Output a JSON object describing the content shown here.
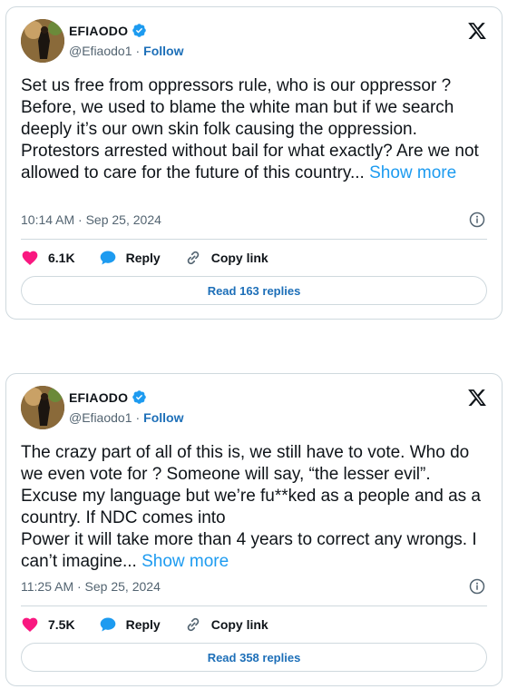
{
  "tweets": [
    {
      "author": {
        "name": "EFIAODO",
        "handle": "@Efiaodo1",
        "follow_label": "Follow"
      },
      "text": "Set us free from oppressors rule, who is our oppressor ? Before, we used to blame the white man but if we search deeply it’s our own skin folk causing the oppression. Protestors arrested without bail for what exactly? Are we not allowed to care for the future of this country...",
      "show_more": "Show more",
      "timestamp": "10:14 AM · Sep 25, 2024",
      "likes": "6.1K",
      "reply_label": "Reply",
      "copy_label": "Copy link",
      "read_replies": "Read 163 replies"
    },
    {
      "author": {
        "name": "EFIAODO",
        "handle": "@Efiaodo1",
        "follow_label": "Follow"
      },
      "text": "The crazy part of all of this is, we still have to vote. Who do we even vote for ? Someone will say, “the lesser evil”. Excuse my language but we’re fu**ked as a people and as a country. If NDC comes into\nPower it will take more than 4 years to correct any wrongs. I can’t imagine...",
      "show_more": "Show more",
      "timestamp": "11:25 AM · Sep 25, 2024",
      "likes": "7.5K",
      "reply_label": "Reply",
      "copy_label": "Copy link",
      "read_replies": "Read 358 replies"
    }
  ],
  "colors": {
    "like": "#f91880",
    "reply": "#1d9bf0",
    "link": "#1d6fb8",
    "verified": "#1d9bf0",
    "muted": "#536471"
  },
  "icons": {
    "brand": "x-logo-icon",
    "verified": "verified-badge-icon",
    "info": "info-icon",
    "like": "heart-icon",
    "reply": "reply-bubble-icon",
    "copy": "link-icon"
  }
}
